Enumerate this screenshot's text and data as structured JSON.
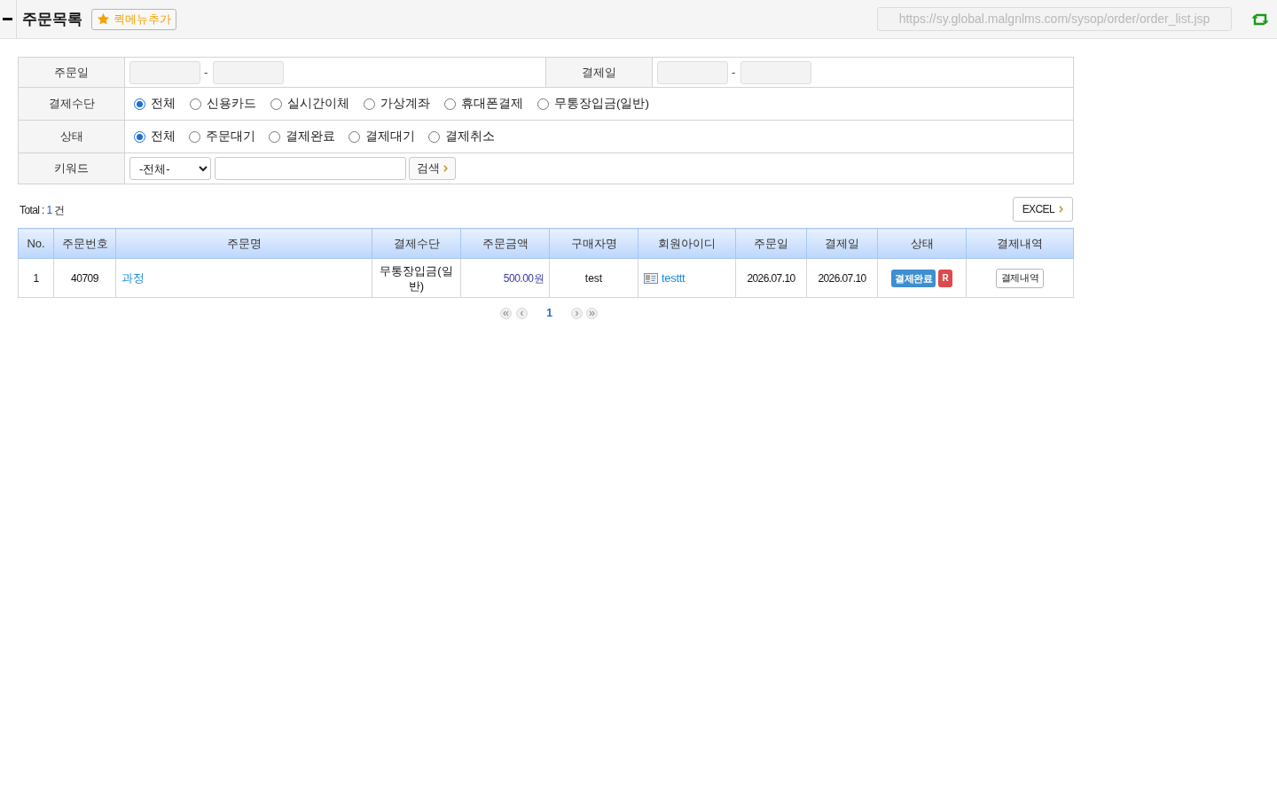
{
  "header": {
    "title": "주문목록",
    "quick_menu_button": "퀵메뉴추가",
    "url": "https://sy.global.malgnlms.com/sysop/order/order_list.jsp"
  },
  "search_form": {
    "order_date": {
      "label": "주문일",
      "separator": "-"
    },
    "payment_date": {
      "label": "결제일",
      "separator": "-"
    },
    "payment_method": {
      "label": "결제수단",
      "options": [
        {
          "label": "전체",
          "selected": true
        },
        {
          "label": "신용카드",
          "selected": false
        },
        {
          "label": "실시간이체",
          "selected": false
        },
        {
          "label": "가상계좌",
          "selected": false
        },
        {
          "label": "휴대폰결제",
          "selected": false
        },
        {
          "label": "무통장입금(일반)",
          "selected": false
        }
      ]
    },
    "status": {
      "label": "상태",
      "options": [
        {
          "label": "전체",
          "selected": true
        },
        {
          "label": "주문대기",
          "selected": false
        },
        {
          "label": "결제완료",
          "selected": false
        },
        {
          "label": "결제대기",
          "selected": false
        },
        {
          "label": "결제취소",
          "selected": false
        }
      ]
    },
    "keyword": {
      "label": "키워드",
      "select": "-전체-",
      "search_button": "검색"
    }
  },
  "summary": {
    "label": "Total :",
    "count": "1",
    "unit": "건"
  },
  "excel_button": "EXCEL",
  "table": {
    "columns": [
      "No.",
      "주문번호",
      "주문명",
      "결제수단",
      "주문금액",
      "구매자명",
      "회원아이디",
      "주문일",
      "결제일",
      "상태",
      "결제내역"
    ],
    "rows": [
      {
        "no": "1",
        "order_no": "40709",
        "order_name": "과정",
        "payment_method": "무통장입금(일반)",
        "amount": "500.00원",
        "buyer": "test",
        "member_id": "testtt",
        "order_date": "2026.07.10",
        "payment_date": "2026.07.10",
        "status": "결제완료",
        "flag": "R",
        "details_button": "결제내역"
      }
    ]
  },
  "pagination": {
    "pages": [
      {
        "label": "1",
        "selected": true
      }
    ]
  }
}
